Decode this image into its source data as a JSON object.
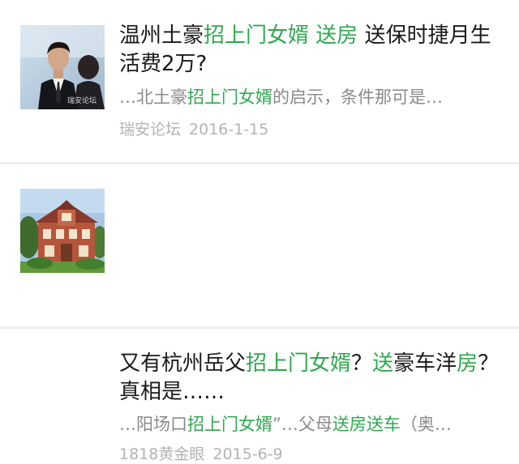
{
  "results": [
    {
      "title_parts": [
        "温州土豪",
        "招上门女婿",
        " ",
        "送房",
        " 送保时捷月生活费2万?"
      ],
      "snippet_parts": [
        "…北土豪",
        "招上门女婿",
        "的启示，条件那可是…"
      ],
      "source": "瑞安论坛",
      "date": "2016-1-15",
      "thumbnail": "man-in-suit-photo",
      "watermark": "瑞安论坛"
    },
    {
      "title_parts": [
        "又有杭州岳父",
        "招上门女婿",
        "？",
        "送",
        "豪车洋",
        "房",
        "？真相是……"
      ],
      "snippet_parts": [
        "…阳场口",
        "招上门女婿",
        "”…父母",
        "送房送车",
        "（奥…"
      ],
      "source": "1818黄金眼",
      "date": "2015-6-9",
      "thumbnail": "villa-house-photo"
    }
  ],
  "colors": {
    "highlight": "#2fa84f",
    "title": "#1a1a1a",
    "snippet": "#8a8a8a",
    "meta": "#b3b3b3",
    "divider": "#ededed"
  }
}
